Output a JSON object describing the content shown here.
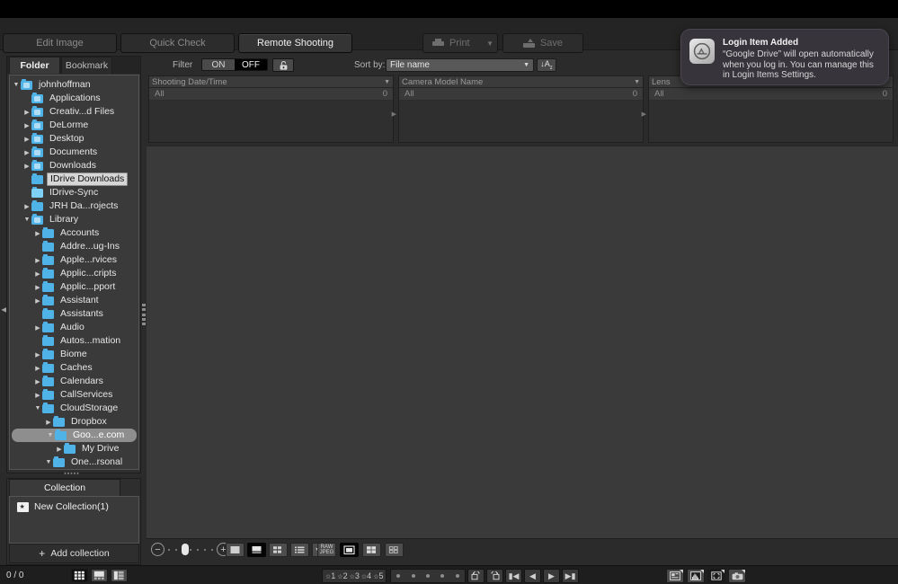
{
  "window": {
    "title": ""
  },
  "modebar": {
    "buttons": [
      {
        "label": "Edit Image",
        "active": false
      },
      {
        "label": "Quick Check",
        "active": false
      },
      {
        "label": "Remote Shooting",
        "active": true
      }
    ]
  },
  "actions": {
    "print_label": "Print",
    "save_label": "Save"
  },
  "notification": {
    "title": "Login Item Added",
    "body": "“Google Drive” will open automatically when you log in. You can manage this in Login Items Settings.",
    "icon": "google-drive-icon"
  },
  "left_panel": {
    "tabs": [
      {
        "label": "Folder",
        "active": true
      },
      {
        "label": "Bookmark",
        "active": false
      }
    ],
    "tree": [
      {
        "label": "johnhoffman",
        "depth": 1,
        "twist": "down",
        "icon": "home-folder",
        "state": "normal"
      },
      {
        "label": "Applications",
        "depth": 2,
        "twist": "",
        "icon": "folder",
        "state": "normal"
      },
      {
        "label": "Creativ...d Files",
        "depth": 2,
        "twist": "right",
        "icon": "folder",
        "state": "normal"
      },
      {
        "label": "DeLorme",
        "depth": 2,
        "twist": "right",
        "icon": "folder",
        "state": "normal"
      },
      {
        "label": "Desktop",
        "depth": 2,
        "twist": "right",
        "icon": "folder",
        "state": "normal"
      },
      {
        "label": "Documents",
        "depth": 2,
        "twist": "right",
        "icon": "folder",
        "state": "normal"
      },
      {
        "label": "Downloads",
        "depth": 2,
        "twist": "right",
        "icon": "folder",
        "state": "normal"
      },
      {
        "label": "IDrive Downloads",
        "depth": 2,
        "twist": "",
        "icon": "folder-plain",
        "state": "renaming"
      },
      {
        "label": "IDrive-Sync",
        "depth": 2,
        "twist": "",
        "icon": "folder-sync",
        "state": "normal"
      },
      {
        "label": "JRH Da...rojects",
        "depth": 2,
        "twist": "right",
        "icon": "folder-plain",
        "state": "normal"
      },
      {
        "label": "Library",
        "depth": 2,
        "twist": "down",
        "icon": "folder",
        "state": "normal"
      },
      {
        "label": "Accounts",
        "depth": 3,
        "twist": "right",
        "icon": "folder-plain",
        "state": "normal"
      },
      {
        "label": "Addre...ug-Ins",
        "depth": 3,
        "twist": "",
        "icon": "folder-plain",
        "state": "normal"
      },
      {
        "label": "Apple...rvices",
        "depth": 3,
        "twist": "right",
        "icon": "folder-plain",
        "state": "normal"
      },
      {
        "label": "Applic...cripts",
        "depth": 3,
        "twist": "right",
        "icon": "folder-plain",
        "state": "normal"
      },
      {
        "label": "Applic...pport",
        "depth": 3,
        "twist": "right",
        "icon": "folder-plain",
        "state": "normal"
      },
      {
        "label": "Assistant",
        "depth": 3,
        "twist": "right",
        "icon": "folder-plain",
        "state": "normal"
      },
      {
        "label": "Assistants",
        "depth": 3,
        "twist": "",
        "icon": "folder-plain",
        "state": "normal"
      },
      {
        "label": "Audio",
        "depth": 3,
        "twist": "right",
        "icon": "folder-plain",
        "state": "normal"
      },
      {
        "label": "Autos...mation",
        "depth": 3,
        "twist": "",
        "icon": "folder-plain",
        "state": "normal"
      },
      {
        "label": "Biome",
        "depth": 3,
        "twist": "right",
        "icon": "folder-plain",
        "state": "normal"
      },
      {
        "label": "Caches",
        "depth": 3,
        "twist": "right",
        "icon": "folder-plain",
        "state": "normal"
      },
      {
        "label": "Calendars",
        "depth": 3,
        "twist": "right",
        "icon": "folder-plain",
        "state": "normal"
      },
      {
        "label": "CallServices",
        "depth": 3,
        "twist": "right",
        "icon": "folder-plain",
        "state": "normal"
      },
      {
        "label": "CloudStorage",
        "depth": 3,
        "twist": "down",
        "icon": "folder-plain",
        "state": "normal"
      },
      {
        "label": "Dropbox",
        "depth": 4,
        "twist": "right",
        "icon": "folder-plain",
        "state": "normal"
      },
      {
        "label": "Goo...e.com",
        "depth": 4,
        "twist": "down",
        "icon": "folder-plain",
        "state": "selected"
      },
      {
        "label": "My Drive",
        "depth": 5,
        "twist": "right",
        "icon": "folder-plain",
        "state": "normal"
      },
      {
        "label": "One...rsonal",
        "depth": 4,
        "twist": "down",
        "icon": "folder-plain",
        "state": "normal"
      }
    ]
  },
  "collection_panel": {
    "tab_label": "Collection",
    "items": [
      {
        "label": "New Collection(1)"
      }
    ],
    "add_label": "Add collection"
  },
  "filter_bar": {
    "filter_label": "Filter",
    "on_label": "ON",
    "off_label": "OFF",
    "active": "OFF",
    "lock_icon": "unlock-icon",
    "sort_label": "Sort by:",
    "sort_value": "File name",
    "sort_direction_icon": "sort-ascending-az-icon"
  },
  "filter_columns": [
    {
      "header": "Shooting Date/Time",
      "rows": [
        {
          "label": "All",
          "count": "0"
        }
      ]
    },
    {
      "header": "Camera Model Name",
      "rows": [
        {
          "label": "All",
          "count": "0"
        }
      ]
    },
    {
      "header": "Lens",
      "rows": [
        {
          "label": "All",
          "count": "0"
        }
      ]
    }
  ],
  "bottom_toolbar": {
    "zoom_out_icon": "zoom-out-icon",
    "zoom_in_icon": "zoom-in-icon",
    "view_modes": [
      {
        "name": "thumbnail-large-view",
        "active": false
      },
      {
        "name": "thumbnail-caption-view",
        "active": true
      },
      {
        "name": "thumbnail-grid-view",
        "active": false
      },
      {
        "name": "list-view",
        "active": false
      },
      {
        "name": "view-options-dropdown",
        "active": false
      }
    ],
    "display_modes": [
      {
        "name": "raw-jpeg-toggle",
        "active": false
      },
      {
        "name": "single-image-display",
        "active": true
      },
      {
        "name": "multi-image-display",
        "active": false
      },
      {
        "name": "quad-image-display",
        "active": false
      }
    ]
  },
  "status_bar": {
    "counter": "0 / 0",
    "layout_buttons": [
      {
        "name": "grid-layout-button",
        "active": true
      },
      {
        "name": "filmstrip-bottom-layout-button",
        "active": false
      },
      {
        "name": "filmstrip-side-layout-button",
        "active": false
      }
    ],
    "ratings": [
      "1",
      "2",
      "3",
      "4",
      "5"
    ],
    "color_labels": 5,
    "rotate_buttons": [
      "rotate-left-icon",
      "rotate-right-icon"
    ],
    "nav_buttons": [
      "go-first-icon",
      "go-previous-icon",
      "go-next-icon",
      "go-last-icon"
    ],
    "tool_buttons": [
      {
        "name": "thumbnail-info-tool",
        "active": false
      },
      {
        "name": "histogram-tool",
        "active": false
      },
      {
        "name": "navigator-tool",
        "active": false
      },
      {
        "name": "camera-tool",
        "active": false
      }
    ]
  }
}
